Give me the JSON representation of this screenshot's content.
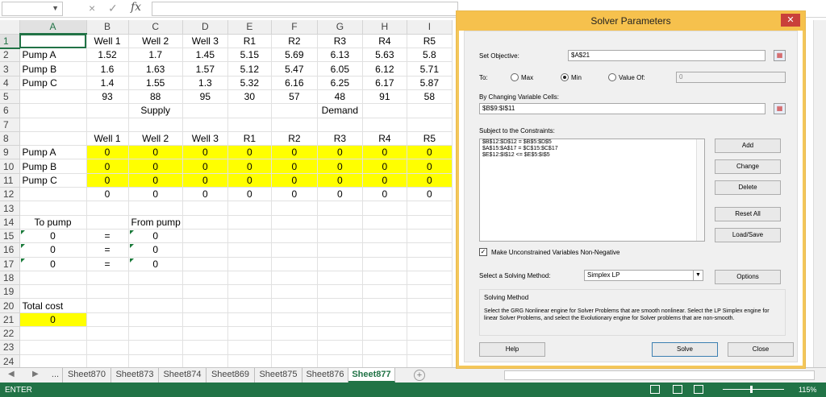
{
  "formula_bar": {
    "fx": "fx",
    "cancel_icon": "×",
    "enter_icon": "✓"
  },
  "columns": [
    "A",
    "B",
    "C",
    "D",
    "E",
    "F",
    "G",
    "H",
    "I"
  ],
  "rows": [
    {
      "n": "1",
      "cells": [
        "",
        "Well 1",
        "Well 2",
        "Well 3",
        "R1",
        "R2",
        "R3",
        "R4",
        "R5"
      ]
    },
    {
      "n": "2",
      "cells": [
        "Pump A",
        "1.52",
        "1.7",
        "1.45",
        "5.15",
        "5.69",
        "6.13",
        "5.63",
        "5.8"
      ]
    },
    {
      "n": "3",
      "cells": [
        "Pump B",
        "1.6",
        "1.63",
        "1.57",
        "5.12",
        "5.47",
        "6.05",
        "6.12",
        "5.71"
      ]
    },
    {
      "n": "4",
      "cells": [
        "Pump C",
        "1.4",
        "1.55",
        "1.3",
        "5.32",
        "6.16",
        "6.25",
        "6.17",
        "5.87"
      ]
    },
    {
      "n": "5",
      "cells": [
        "",
        "93",
        "88",
        "95",
        "30",
        "57",
        "48",
        "91",
        "58"
      ]
    },
    {
      "n": "6",
      "cells": [
        "",
        "",
        "Supply",
        "",
        "",
        "",
        "Demand",
        "",
        ""
      ]
    },
    {
      "n": "7",
      "cells": [
        "",
        "",
        "",
        "",
        "",
        "",
        "",
        "",
        ""
      ]
    },
    {
      "n": "8",
      "cells": [
        "",
        "Well 1",
        "Well 2",
        "Well 3",
        "R1",
        "R2",
        "R3",
        "R4",
        "R5"
      ]
    },
    {
      "n": "9",
      "cells": [
        "Pump A",
        "0",
        "0",
        "0",
        "0",
        "0",
        "0",
        "0",
        "0"
      ]
    },
    {
      "n": "10",
      "cells": [
        "Pump B",
        "0",
        "0",
        "0",
        "0",
        "0",
        "0",
        "0",
        "0"
      ]
    },
    {
      "n": "11",
      "cells": [
        "Pump C",
        "0",
        "0",
        "0",
        "0",
        "0",
        "0",
        "0",
        "0"
      ]
    },
    {
      "n": "12",
      "cells": [
        "",
        "0",
        "0",
        "0",
        "0",
        "0",
        "0",
        "0",
        "0"
      ]
    },
    {
      "n": "13",
      "cells": [
        "",
        "",
        "",
        "",
        "",
        "",
        "",
        "",
        ""
      ]
    },
    {
      "n": "14",
      "cells": [
        "To pump",
        "",
        "From pump",
        "",
        "",
        "",
        "",
        "",
        ""
      ]
    },
    {
      "n": "15",
      "cells": [
        "0",
        "=",
        "0",
        "",
        "",
        "",
        "",
        "",
        ""
      ]
    },
    {
      "n": "16",
      "cells": [
        "0",
        "=",
        "0",
        "",
        "",
        "",
        "",
        "",
        ""
      ]
    },
    {
      "n": "17",
      "cells": [
        "0",
        "=",
        "0",
        "",
        "",
        "",
        "",
        "",
        ""
      ]
    },
    {
      "n": "18",
      "cells": [
        "",
        "",
        "",
        "",
        "",
        "",
        "",
        "",
        ""
      ]
    },
    {
      "n": "19",
      "cells": [
        "",
        "",
        "",
        "",
        "",
        "",
        "",
        "",
        ""
      ]
    },
    {
      "n": "20",
      "cells": [
        "Total cost",
        "",
        "",
        "",
        "",
        "",
        "",
        "",
        ""
      ]
    },
    {
      "n": "21",
      "cells": [
        "0",
        "",
        "",
        "",
        "",
        "",
        "",
        "",
        ""
      ]
    },
    {
      "n": "22",
      "cells": [
        "",
        "",
        "",
        "",
        "",
        "",
        "",
        "",
        ""
      ]
    },
    {
      "n": "23",
      "cells": [
        "",
        "",
        "",
        "",
        "",
        "",
        "",
        "",
        ""
      ]
    },
    {
      "n": "24",
      "cells": [
        "",
        "",
        "",
        "",
        "",
        "",
        "",
        "",
        ""
      ]
    }
  ],
  "sheet_tabs": [
    "...",
    "Sheet870",
    "Sheet873",
    "Sheet874",
    "Sheet869",
    "Sheet875",
    "Sheet876",
    "Sheet877"
  ],
  "active_tab": "Sheet877",
  "status": {
    "mode": "ENTER",
    "zoom": "115%"
  },
  "colors": {
    "excel_green": "#217346",
    "highlight_yellow": "#ffff00",
    "dialog_title": "#f6c14d"
  },
  "solver": {
    "title": "Solver Parameters",
    "objective_label": "Set Objective:",
    "objective_value": "$A$21",
    "to_label": "To:",
    "opt_max": "Max",
    "opt_min": "Min",
    "opt_value": "Value Of:",
    "value_of": "0",
    "selected": "Min",
    "changing_label": "By Changing Variable Cells:",
    "changing_value": "$B$9:$I$11",
    "constraints_label": "Subject to the Constraints:",
    "constraints": [
      "$B$12:$D$12 = $B$5:$D$5",
      "$A$15:$A$17 = $C$15:$C$17",
      "$E$12:$I$12 <= $E$5:$I$5"
    ],
    "btn_add": "Add",
    "btn_change": "Change",
    "btn_delete": "Delete",
    "btn_reset": "Reset All",
    "btn_load": "Load/Save",
    "nonneg_label": "Make Unconstrained Variables Non-Negative",
    "method_label": "Select a Solving Method:",
    "method_value": "Simplex LP",
    "btn_options": "Options",
    "group_title": "Solving Method",
    "group_text": "Select the GRG Nonlinear engine for Solver Problems that are smooth nonlinear. Select the LP Simplex engine for linear Solver Problems, and select the Evolutionary engine for Solver problems that are non-smooth.",
    "btn_help": "Help",
    "btn_solve": "Solve",
    "btn_close": "Close"
  }
}
